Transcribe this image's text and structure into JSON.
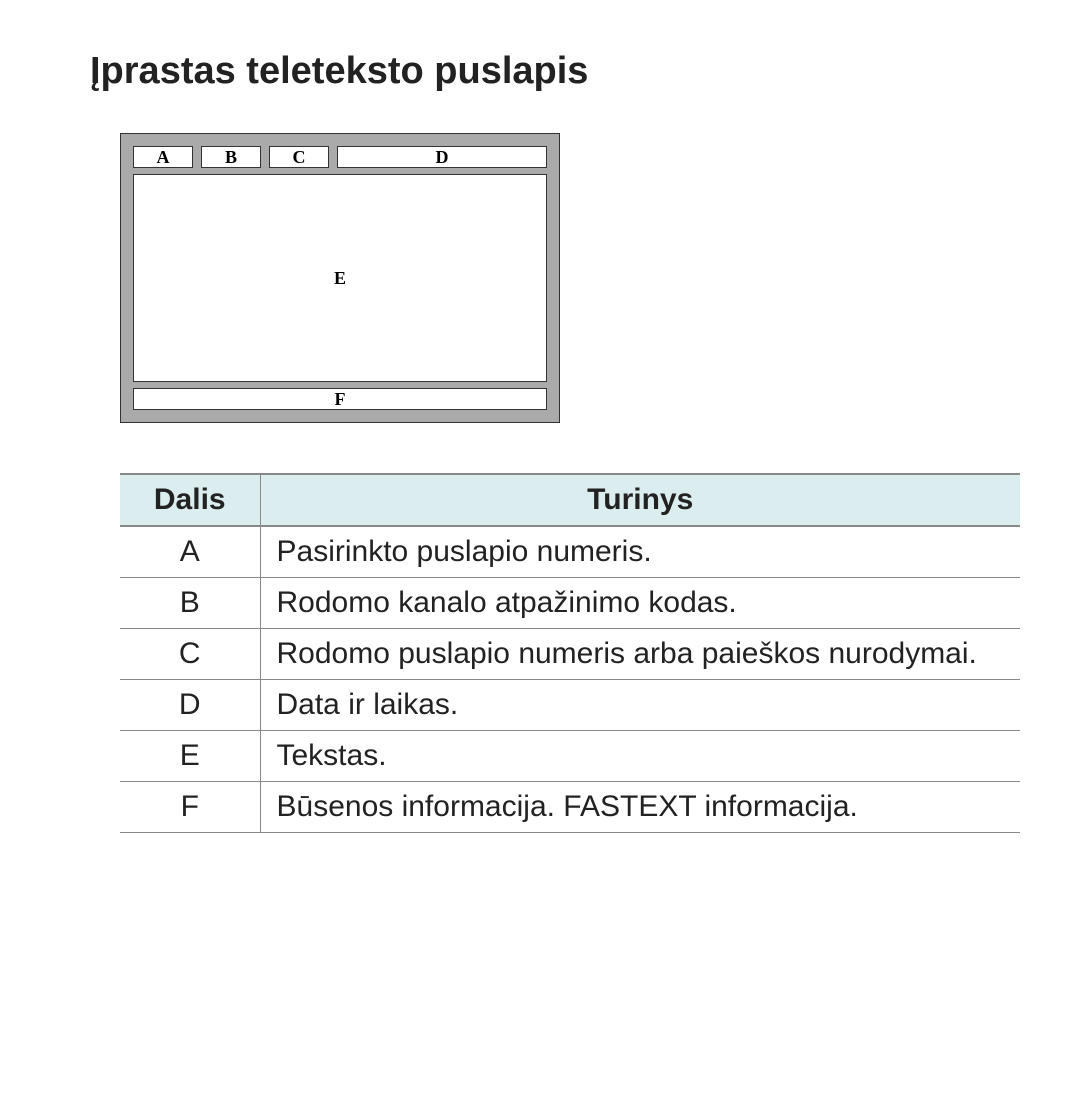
{
  "title": "Įprastas teleteksto puslapis",
  "diagram": {
    "a": "A",
    "b": "B",
    "c": "C",
    "d": "D",
    "e": "E",
    "f": "F"
  },
  "table": {
    "headers": {
      "part": "Dalis",
      "content": "Turinys"
    },
    "rows": [
      {
        "part": "A",
        "content": "Pasirinkto puslapio numeris."
      },
      {
        "part": "B",
        "content": "Rodomo kanalo atpažinimo kodas."
      },
      {
        "part": "C",
        "content": "Rodomo puslapio numeris arba paieškos nurodymai."
      },
      {
        "part": "D",
        "content": "Data ir laikas."
      },
      {
        "part": "E",
        "content": "Tekstas."
      },
      {
        "part": "F",
        "content": "Būsenos informacija. FASTEXT informacija."
      }
    ]
  }
}
